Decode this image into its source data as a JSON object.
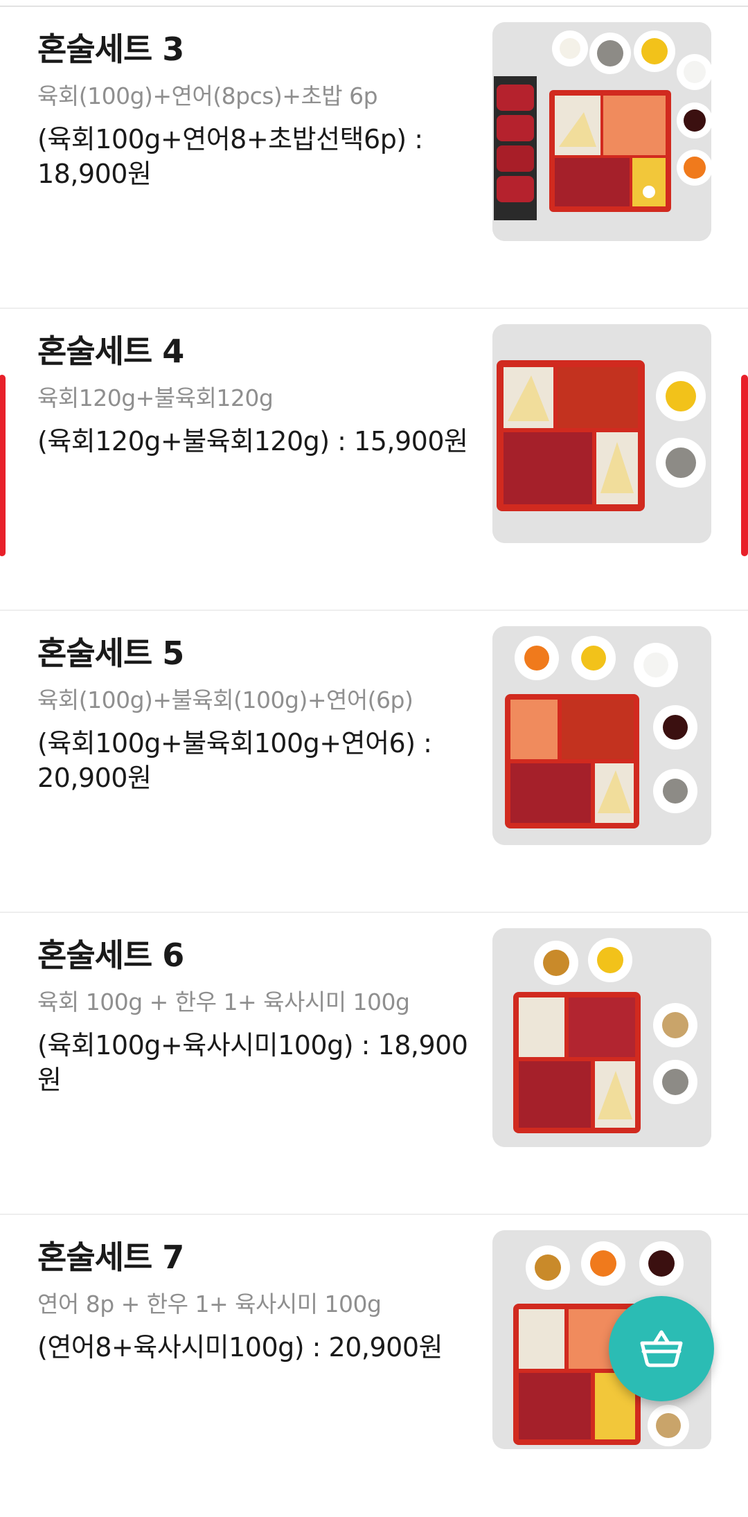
{
  "menu": {
    "items": [
      {
        "name": "혼술세트 3",
        "description": "육회(100g)+연어(8pcs)+초밥 6p",
        "price_line1": "(육회100g+연어8+초밥선택6p) :",
        "price_line2": "18,900원"
      },
      {
        "name": "혼술세트 4",
        "description": "육회120g+불육회120g",
        "price_line1": "(육회120g+불육회120g) : 15,900원",
        "price_line2": ""
      },
      {
        "name": "혼술세트 5",
        "description": "육회(100g)+불육회(100g)+연어(6p)",
        "price_line1": "(육회100g+불육회100g+연어6) :",
        "price_line2": "20,900원"
      },
      {
        "name": "혼술세트 6",
        "description": "육회 100g + 한우 1+ 육사시미 100g",
        "price_line1": "(육회100g+육사시미100g) : 18,900원",
        "price_line2": ""
      },
      {
        "name": "혼술세트 7",
        "description": "연어 8p + 한우 1+ 육사시미 100g",
        "price_line1": "(연어8+육사시미100g) : 20,900원",
        "price_line2": ""
      }
    ]
  },
  "cart_button": {
    "icon": "basket-icon"
  },
  "colors": {
    "accent_red": "#e8202a",
    "fab_teal": "#2bbcb4",
    "description_gray": "#8f8f8f"
  }
}
